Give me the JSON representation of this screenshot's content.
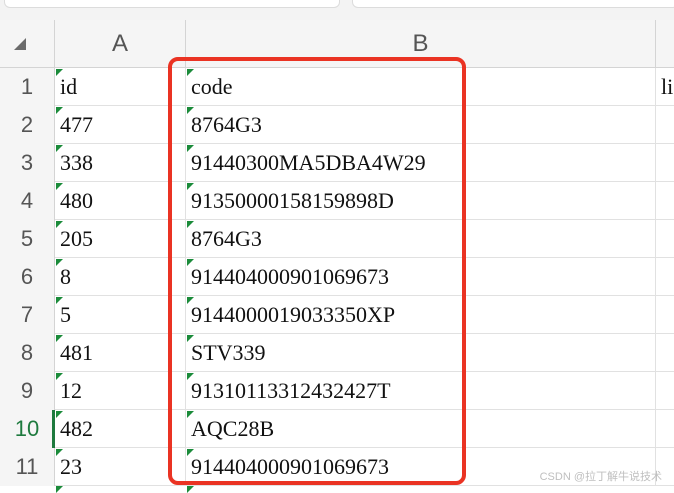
{
  "sheet": {
    "columns": [
      "A",
      "B",
      ""
    ],
    "rows": [
      {
        "num": "1",
        "a": "id",
        "b": "code",
        "c": "li"
      },
      {
        "num": "2",
        "a": "477",
        "b": "8764G3",
        "c": ""
      },
      {
        "num": "3",
        "a": "338",
        "b": "91440300MA5DBA4W29",
        "c": ""
      },
      {
        "num": "4",
        "a": "480",
        "b": "91350000158159898D",
        "c": ""
      },
      {
        "num": "5",
        "a": "205",
        "b": "8764G3",
        "c": ""
      },
      {
        "num": "6",
        "a": "8",
        "b": "914404000901069673",
        "c": ""
      },
      {
        "num": "7",
        "a": "5",
        "b": "9144000019033350XP",
        "c": ""
      },
      {
        "num": "8",
        "a": "481",
        "b": "STV339",
        "c": ""
      },
      {
        "num": "9",
        "a": "12",
        "b": "91310113312432427T",
        "c": ""
      },
      {
        "num": "10",
        "a": "482",
        "b": "AQC28B",
        "c": ""
      },
      {
        "num": "11",
        "a": "23",
        "b": "914404000901069673",
        "c": ""
      }
    ],
    "active_row": "10"
  },
  "colors": {
    "highlight": "#ea3323",
    "flag": "#1b8b3a",
    "active": "#1e7a3e"
  },
  "watermark": "CSDN @拉丁解牛说技术"
}
